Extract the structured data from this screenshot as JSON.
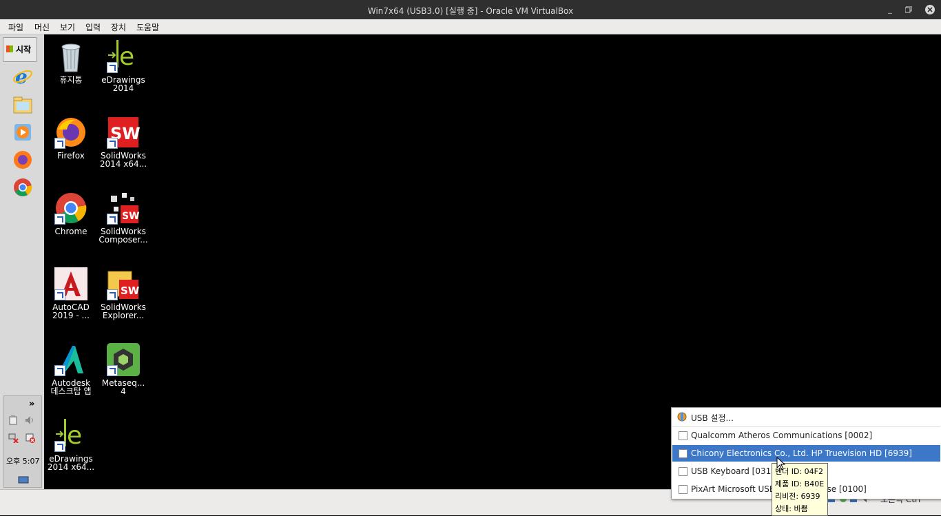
{
  "window": {
    "title": "Win7x64 (USB3.0) [실행 중] - Oracle VM VirtualBox"
  },
  "menu": [
    "파일",
    "머신",
    "보기",
    "입력",
    "장치",
    "도움말"
  ],
  "start_label": "시작",
  "tray": {
    "expand": "»",
    "time": "오후 5:07"
  },
  "desktop_icons": [
    {
      "label": "휴지통",
      "label2": ""
    },
    {
      "label": "eDrawings",
      "label2": "2014"
    },
    {
      "label": "Firefox",
      "label2": ""
    },
    {
      "label": "SolidWorks",
      "label2": "2014 x64..."
    },
    {
      "label": "Chrome",
      "label2": ""
    },
    {
      "label": "SolidWorks",
      "label2": "Composer..."
    },
    {
      "label": "AutoCAD",
      "label2": "2019 - ..."
    },
    {
      "label": "SolidWorks",
      "label2": "Explorer..."
    },
    {
      "label": "Autodesk",
      "label2": "데스크탑 앱"
    },
    {
      "label": "Metaseq...",
      "label2": "4"
    },
    {
      "label": "eDrawings",
      "label2": "2014 x64..."
    }
  ],
  "usb_menu": {
    "settings": "USB 설정...",
    "devices": [
      "Qualcomm Atheros Communications  [0002]",
      "Chicony Electronics Co., Ltd. HP Truevision HD [6939]",
      "USB Keyboard [0310]",
      "PixArt Microsoft USB Optical Mouse [0100]"
    ]
  },
  "tooltip": {
    "vendor": "벤더 ID: 04F2",
    "product": "제품 ID: B40E",
    "revision": "리비전: 6939",
    "state": "상태: 바쁨"
  },
  "statusbar": {
    "host_key": "오른쪽 Ctrl"
  },
  "colors": {
    "selection": "#3d78c8",
    "tooltip_bg": "#ffffdc",
    "titlebar": "#2f2f2f"
  }
}
